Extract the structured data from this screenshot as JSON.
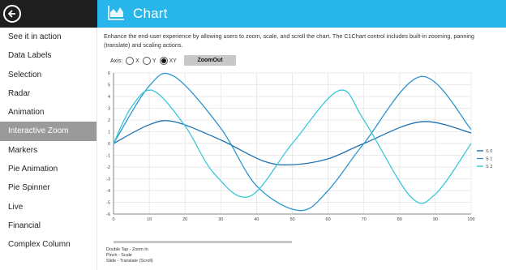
{
  "header": {
    "title": "Chart"
  },
  "icons": {
    "back": "back-arrow-icon",
    "chart": "chart-icon"
  },
  "colors": {
    "accent": "#27b5ea",
    "nav_selected": "#9a9a9a",
    "series0": "#1f6fae",
    "series1": "#2b95cc",
    "series2": "#3cc8d8"
  },
  "sidebar": {
    "items": [
      {
        "label": "See it in action"
      },
      {
        "label": "Data Labels"
      },
      {
        "label": "Selection"
      },
      {
        "label": "Radar"
      },
      {
        "label": "Animation"
      },
      {
        "label": "Interactive Zoom",
        "selected": true
      },
      {
        "label": "Markers"
      },
      {
        "label": "Pie Animation"
      },
      {
        "label": "Pie Spinner"
      },
      {
        "label": "Live"
      },
      {
        "label": "Financial"
      },
      {
        "label": "Complex Column"
      }
    ]
  },
  "description": "Enhance the end-user experience by allowing users to zoom, scale, and scroll the chart. The C1Chart control includes built-in zooming, panning (translate) and scaling actions.",
  "axis_selector": {
    "label": "Axis:",
    "options": [
      {
        "label": "X"
      },
      {
        "label": "Y"
      },
      {
        "label": "XY",
        "selected": true
      }
    ]
  },
  "zoomout_label": "ZoomOut",
  "instructions": [
    "Double Tap - Zoom In",
    "Pinch - Scale",
    "Slide - Translate (Scroll)"
  ],
  "chart_data": {
    "type": "line",
    "xlim": [
      0,
      100
    ],
    "ylim": [
      -6,
      6
    ],
    "x_ticks": [
      0,
      10,
      20,
      30,
      40,
      50,
      60,
      70,
      80,
      90,
      100
    ],
    "y_ticks": [
      -6,
      -5,
      -4,
      -3,
      -2,
      -1,
      0,
      1,
      2,
      3,
      4,
      5,
      6
    ],
    "grid": true,
    "legend": "right",
    "series": [
      {
        "name": "S 0",
        "color": "#1f6fae",
        "x": [
          0,
          10,
          17,
          30,
          42,
          50,
          60,
          70,
          86,
          100
        ],
        "y": [
          0,
          1.6,
          1.85,
          0.3,
          -1.5,
          -1.8,
          -1.3,
          0,
          1.85,
          0.9
        ]
      },
      {
        "name": "S 1",
        "color": "#2b95cc",
        "x": [
          0,
          10,
          17,
          30,
          40,
          52,
          60,
          70,
          86,
          100
        ],
        "y": [
          0,
          4.9,
          5.7,
          1.3,
          -3.6,
          -5.7,
          -4.0,
          0,
          5.7,
          1.2
        ]
      },
      {
        "name": "S 2",
        "color": "#3cc8d8",
        "x": [
          0,
          5,
          11,
          20,
          28,
          38,
          50,
          63,
          70,
          83,
          90,
          100
        ],
        "y": [
          0,
          3.1,
          4.5,
          1.5,
          -2.5,
          -4.5,
          0,
          4.5,
          2.0,
          -4.5,
          -4.3,
          0
        ]
      }
    ]
  }
}
